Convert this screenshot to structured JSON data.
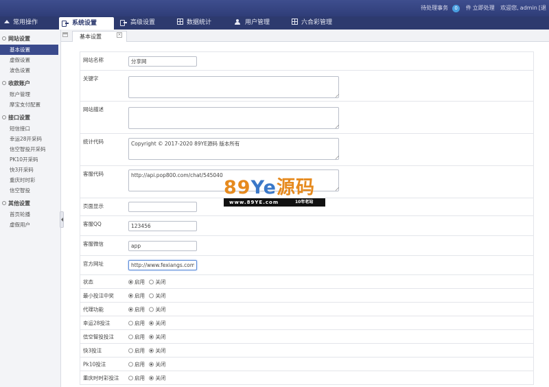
{
  "topbar": {
    "pending_label": "待处理事务",
    "pending_count": "0",
    "pending_unit": "件",
    "process_now": "立即处理",
    "welcome": "欢迎您,",
    "username": "admin",
    "trailing": "[退"
  },
  "nav": {
    "items": [
      {
        "label": "常用操作",
        "icon": "home-icon"
      },
      {
        "label": "系统设置",
        "icon": "key-icon",
        "active": true
      },
      {
        "label": "高级设置",
        "icon": "key-icon"
      },
      {
        "label": "数据统计",
        "icon": "grid-icon"
      },
      {
        "label": "用户管理",
        "icon": "user-icon"
      },
      {
        "label": "六合彩管理",
        "icon": "grid-icon"
      }
    ]
  },
  "sidebar": {
    "groups": [
      {
        "title": "网站设置",
        "items": [
          "基本设置",
          "虚假设置",
          "波色设置"
        ]
      },
      {
        "title": "收款账户",
        "items": [
          "账户管理",
          "摩宝支付配置"
        ]
      },
      {
        "title": "接口设置",
        "items": [
          "短信接口",
          "幸运28开采码",
          "信空智投开采码",
          "PK10开采码",
          "快3开采码",
          "重庆时时彩",
          "信空智投"
        ]
      },
      {
        "title": "其他设置",
        "items": [
          "首页轮播",
          "虚假用户"
        ]
      }
    ]
  },
  "tabs": {
    "active_label": "基本设置",
    "close_glyph": "×"
  },
  "form": {
    "site_name_label": "网站名称",
    "site_name_value": "分享网",
    "keywords_label": "关键字",
    "keywords_value": "",
    "description_label": "网站描述",
    "description_value": "",
    "stats_label": "统计代码",
    "stats_value": "Copyright © 2017-2020 89YE源码 版本所有",
    "service_label": "客服代码",
    "service_value": "http://api.pop800.com/chat/545040",
    "page_show_label": "页面显示",
    "page_show_value": "",
    "qq_label": "客服QQ",
    "qq_value": "123456",
    "wechat_label": "客服微信",
    "wechat_value": "app",
    "official_label": "官方网址",
    "official_value": "http://www.fexiangs.com",
    "radio_on_label": "启用",
    "radio_off_label": "关闭",
    "toggles": [
      {
        "label": "状态",
        "enabled": true
      },
      {
        "label": "最小投注中奖",
        "enabled": true
      },
      {
        "label": "代理功能",
        "enabled": true
      },
      {
        "label": "幸运28投注",
        "enabled": false
      },
      {
        "label": "信空智投投注",
        "enabled": false
      },
      {
        "label": "快3投注",
        "enabled": false
      },
      {
        "label": "Pk10投注",
        "enabled": false
      },
      {
        "label": "重庆时时彩投注",
        "enabled": false
      }
    ]
  },
  "watermark": {
    "brand_a": "89",
    "brand_b": "Ye",
    "brand_c": "源码",
    "url": "www.89YE.com",
    "tagline": "10年老站"
  }
}
